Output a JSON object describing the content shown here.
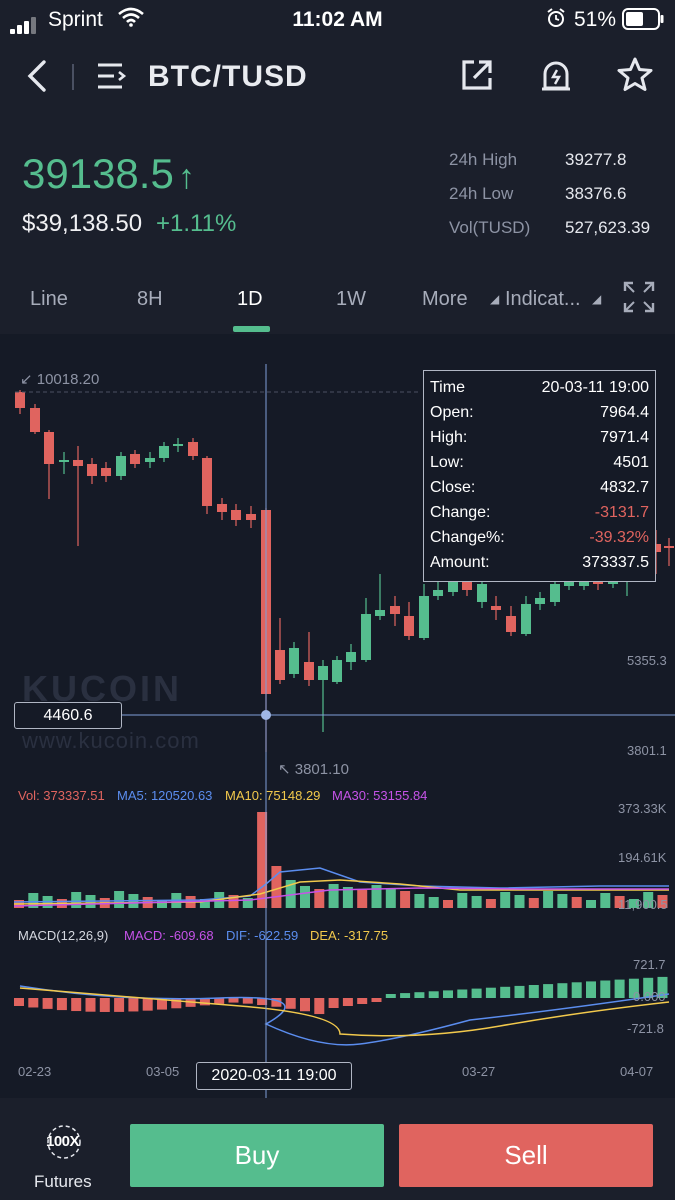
{
  "status_bar": {
    "carrier": "Sprint",
    "time": "11:02 AM",
    "battery": "51%"
  },
  "header": {
    "title": "BTC/TUSD"
  },
  "price": {
    "last": "39138.5",
    "usd": "$39,138.50",
    "change_pct": "+1.11%"
  },
  "stats": [
    {
      "label": "24h High",
      "value": "39277.8"
    },
    {
      "label": "24h Low",
      "value": "38376.6"
    },
    {
      "label": "Vol(TUSD)",
      "value": "527,623.39"
    }
  ],
  "tabs": [
    "Line",
    "8H",
    "1D",
    "1W",
    "More",
    "Indicat..."
  ],
  "active_tab": "1D",
  "chart": {
    "high_marker": "10018.20",
    "low_marker": "3801.10",
    "crosshair_price": "4460.6",
    "crosshair_date": "2020-03-11 19:00",
    "price_axis": [
      "5355.3",
      "3801.1"
    ],
    "vol_axis": [
      "373.33K",
      "194.61K",
      "11,900.5"
    ],
    "macd_axis": [
      "721.7",
      "0.000",
      "-721.8"
    ],
    "date_axis": [
      "02-23",
      "03-05",
      "03-27",
      "04-07"
    ],
    "watermark": "KUCOIN",
    "watermark_url": "www.kucoin.com",
    "indicators": {
      "vol": "Vol: 373337.51",
      "ma5": "MA5: 120520.63",
      "ma10": "MA10: 75148.29",
      "ma30": "MA30: 53155.84",
      "macd_title": "MACD(12,26,9)",
      "macd": "MACD: -609.68",
      "dif": "DIF: -622.59",
      "dea": "DEA: -317.75"
    },
    "tooltip": [
      {
        "k": "Time",
        "v": "20-03-11 19:00"
      },
      {
        "k": "Open:",
        "v": "7964.4"
      },
      {
        "k": "High:",
        "v": "7971.4"
      },
      {
        "k": "Low:",
        "v": "4501"
      },
      {
        "k": "Close:",
        "v": "4832.7"
      },
      {
        "k": "Change:",
        "v": "-3131.7"
      },
      {
        "k": "Change%:",
        "v": "-39.32%"
      },
      {
        "k": "Amount:",
        "v": "373337.5"
      }
    ],
    "colors": {
      "up": "#55bd8e",
      "down": "#e0645f",
      "ma5": "#5b8def",
      "ma10": "#f2c94c",
      "ma30": "#c653e8"
    }
  },
  "bottom": {
    "futures_label": "Futures",
    "futures_badge": "100X",
    "buy": "Buy",
    "sell": "Sell"
  }
}
